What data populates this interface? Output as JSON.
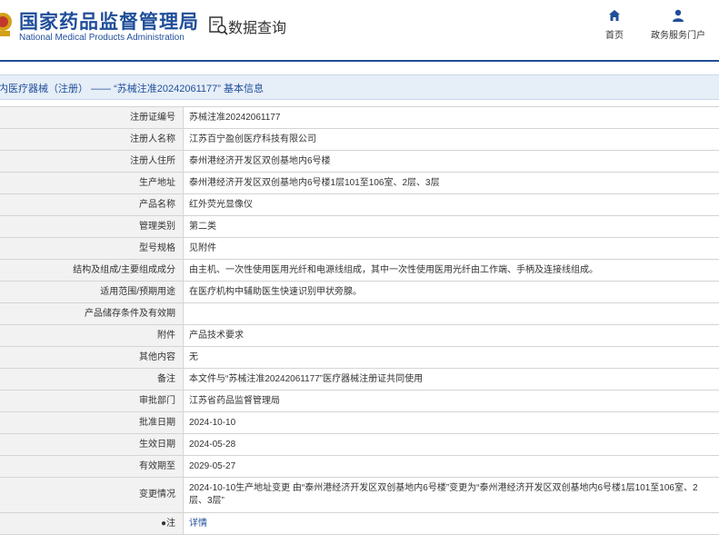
{
  "header": {
    "logo_cn": "国家药品监督管理局",
    "logo_en": "National Medical Products Administration",
    "query_title": "数据查询",
    "nav": [
      {
        "label": "首页",
        "icon": "home-icon"
      },
      {
        "label": "政务服务门户",
        "icon": "user-icon"
      }
    ]
  },
  "colors": {
    "brand": "#1f4e9a",
    "title_bg": "#e6eef7",
    "label_bg": "#f2f2f2"
  },
  "title_bar": "内医疗器械（注册） —— “苏械注准20242061177” 基本信息",
  "rows": [
    {
      "label": "注册证编号",
      "value": "苏械注准20242061177"
    },
    {
      "label": "注册人名称",
      "value": "江苏百宁盈创医疗科技有限公司"
    },
    {
      "label": "注册人住所",
      "value": "泰州港经济开发区双创基地内6号楼"
    },
    {
      "label": "生产地址",
      "value": "泰州港经济开发区双创基地内6号楼1层101至106室、2层、3层"
    },
    {
      "label": "产品名称",
      "value": "红外荧光显像仪"
    },
    {
      "label": "管理类别",
      "value": "第二类"
    },
    {
      "label": "型号规格",
      "value": "见附件"
    },
    {
      "label": "结构及组成/主要组成成分",
      "value": "由主机、一次性使用医用光纤和电源线组成，其中一次性使用医用光纤由工作端、手柄及连接线组成。"
    },
    {
      "label": "适用范围/预期用途",
      "value": "在医疗机构中辅助医生快速识别甲状旁腺。"
    },
    {
      "label": "产品储存条件及有效期",
      "value": ""
    },
    {
      "label": "附件",
      "value": "产品技术要求"
    },
    {
      "label": "其他内容",
      "value": "无"
    },
    {
      "label": "备注",
      "value": "本文件与“苏械注准20242061177”医疗器械注册证共同使用"
    },
    {
      "label": "审批部门",
      "value": "江苏省药品监督管理局"
    },
    {
      "label": "批准日期",
      "value": "2024-10-10"
    },
    {
      "label": "生效日期",
      "value": "2024-05-28"
    },
    {
      "label": "有效期至",
      "value": "2029-05-27"
    },
    {
      "label": "变更情况",
      "value": "2024-10-10生产地址变更 由“泰州港经济开发区双创基地内6号楼”变更为“泰州港经济开发区双创基地内6号楼1层101至106室、2层、3层”"
    },
    {
      "label": "●注",
      "value": "详情"
    }
  ]
}
